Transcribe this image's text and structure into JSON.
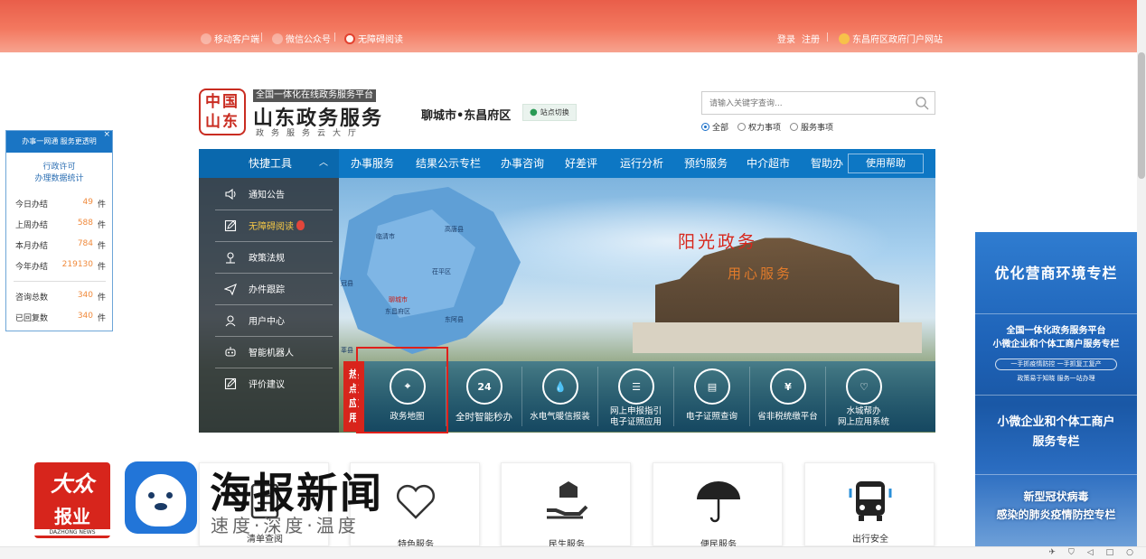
{
  "topbar": {
    "mobile": "移动客户端",
    "wechat": "微信公众号",
    "accessible": "无障碍阅读",
    "login": "登录",
    "register": "注册",
    "portal": "东昌府区政府门户网站"
  },
  "header": {
    "seal_text": "中国山东",
    "platform_tag": "全国一体化在线政务服务平台",
    "title": "山东政务服务",
    "subtitle": "政务服务云大厅",
    "region": "聊城市•东昌府区",
    "switch_label": "站点切换",
    "search": {
      "placeholder": "请输入关键字查询..."
    },
    "radios": [
      {
        "label": "全部",
        "checked": true
      },
      {
        "label": "权力事项",
        "checked": false
      },
      {
        "label": "服务事项",
        "checked": false
      }
    ]
  },
  "nav": {
    "quick": "快捷工具",
    "items": [
      "办事服务",
      "结果公示专栏",
      "办事咨询",
      "好差评",
      "运行分析",
      "预约服务",
      "中介超市",
      "智助办"
    ],
    "help": "使用帮助"
  },
  "quick_menu": [
    {
      "label": "通知公告",
      "icon": "speaker-icon"
    },
    {
      "label": "无障碍阅读",
      "icon": "edit-icon"
    },
    {
      "label": "政策法规",
      "icon": "scale-icon"
    },
    {
      "label": "办件跟踪",
      "icon": "send-icon"
    },
    {
      "label": "用户中心",
      "icon": "user-icon"
    },
    {
      "label": "智能机器人",
      "icon": "robot-icon"
    },
    {
      "label": "评价建议",
      "icon": "comment-icon"
    }
  ],
  "banner": {
    "slogan1": "阳光政务",
    "slogan2": "用心服务",
    "map_labels": [
      "临清市",
      "高唐县",
      "茌平区",
      "聊城市",
      "东昌府区",
      "东阿县",
      "冠县",
      "莘县"
    ]
  },
  "hot_apps": {
    "tag": "热点应用",
    "items": [
      {
        "label": "政务地图",
        "icon_text": "⌖"
      },
      {
        "label": "全时智能秒办",
        "icon_text": "24"
      },
      {
        "label": "水电气暖信报装",
        "icon_text": "💧"
      },
      {
        "label": "网上申报指引\n电子证照应用",
        "icon_text": "☰"
      },
      {
        "label": "电子证照查询",
        "icon_text": "▤"
      },
      {
        "label": "省非税统缴平台",
        "icon_text": "¥"
      },
      {
        "label": "水城帮办\n网上应用系统",
        "icon_text": "♡"
      }
    ]
  },
  "stats": {
    "header": "办事一网通 服务更透明",
    "close": "×",
    "subtitle_line1": "行政许可",
    "subtitle_line2": "办理数据统计",
    "rows": [
      {
        "label": "今日办结",
        "value": "49",
        "unit": "件"
      },
      {
        "label": "上周办结",
        "value": "588",
        "unit": "件"
      },
      {
        "label": "本月办结",
        "value": "784",
        "unit": "件"
      },
      {
        "label": "今年办结",
        "value": "219130",
        "unit": "件"
      },
      {
        "label": "咨询总数",
        "value": "340",
        "unit": "件"
      },
      {
        "label": "已回复数",
        "value": "340",
        "unit": "件"
      }
    ]
  },
  "right_ad": {
    "title1": "优化营商环境专栏",
    "title2_line1": "全国一体化政务服务平台",
    "title2_line2": "小微企业和个体工商户服务专栏",
    "pill": "一手抓疫情防控 一手抓复工复产",
    "small": "政策易于知晓 服务一站办理",
    "title3_line1": "小微企业和个体工商户",
    "title3_line2": "服务专栏",
    "title4_line1": "新型冠状病毒",
    "title4_line2": "感染的肺炎疫情防控专栏"
  },
  "cards": [
    "清单查阅",
    "特色服务",
    "民生服务",
    "便民服务",
    "出行安全"
  ],
  "watermark": {
    "dazhong_top": "大众",
    "dazhong_bottom": "报业",
    "dazhong_en": "DAZHONG NEWS",
    "haibao": "海报新闻",
    "haibao_sub": "速度·深度·温度"
  },
  "colors": {
    "brand_blue": "#0d77c4",
    "accent_red": "#d7251c",
    "topbar": "#ef6a52"
  }
}
